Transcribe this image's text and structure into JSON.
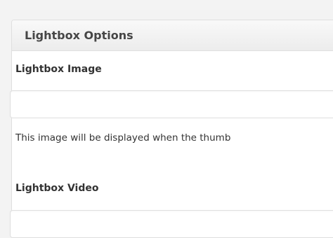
{
  "panel": {
    "title": "Lightbox Options"
  },
  "fields": {
    "image": {
      "label": "Lightbox Image",
      "value": "",
      "description": "This image will be displayed when the thumb"
    },
    "video": {
      "label": "Lightbox Video",
      "value": ""
    }
  },
  "colors": {
    "page_background": "#f3f3f3",
    "panel_border": "#dfdfdf",
    "header_background": "#ececec",
    "title_text": "#464646",
    "body_text": "#333333"
  }
}
